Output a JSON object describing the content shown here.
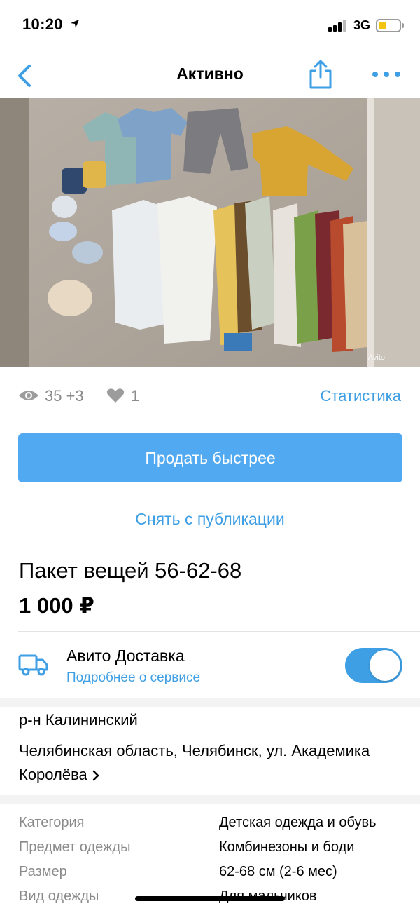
{
  "status_bar": {
    "time": "10:20",
    "network": "3G",
    "battery_level": 0.35
  },
  "nav": {
    "title": "Активно",
    "back_icon": "chevron-left-icon",
    "share_icon": "share-icon",
    "more_icon": "more-icon"
  },
  "photo": {
    "watermark": "Avito",
    "alt": ""
  },
  "stats": {
    "views": "35 +3",
    "likes": "1",
    "statistics_link": "Статистика"
  },
  "actions": {
    "sell_faster": "Продать быстрее",
    "unpublish": "Снять с публикации"
  },
  "listing": {
    "title": "Пакет вещей 56-62-68",
    "price": "1 000 ₽"
  },
  "delivery": {
    "title": "Авито Доставка",
    "link": "Подробнее о сервисе",
    "enabled": true
  },
  "location": {
    "district": "р-н Калининский",
    "address": "Челябинская область, Челябинск, ул. Академика Королёва"
  },
  "params": [
    {
      "key": "Категория",
      "value": "Детская одежда и обувь"
    },
    {
      "key": "Предмет одежды",
      "value": "Комбинезоны и боди"
    },
    {
      "key": "Размер",
      "value": "62-68 см (2-6 мес)"
    },
    {
      "key": "Вид одежды",
      "value": "Для мальчиков"
    }
  ],
  "colors": {
    "accent": "#3e9fe4",
    "button": "#51a9f1",
    "muted": "#8a8a8a"
  }
}
